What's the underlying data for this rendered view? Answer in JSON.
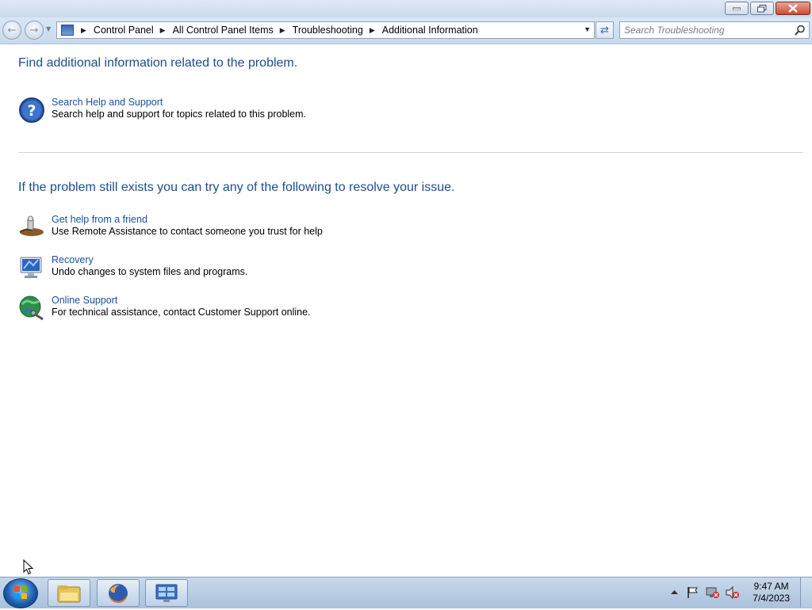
{
  "window": {
    "buttons": [
      "minimize",
      "maximize",
      "close"
    ]
  },
  "navbar": {
    "breadcrumbs": [
      "Control Panel",
      "All Control Panel Items",
      "Troubleshooting",
      "Additional Information"
    ],
    "search_placeholder": "Search Troubleshooting"
  },
  "content": {
    "heading1": "Find additional information related to the problem.",
    "help_task": {
      "link": "Search Help and Support",
      "description": "Search help and support for topics related to this problem.",
      "icon": "help-icon"
    },
    "heading2": "If the problem still exists you can try any of the following to resolve your issue.",
    "tasks": [
      {
        "link": "Get help from a friend",
        "description": "Use Remote Assistance to contact someone you trust for help",
        "icon": "remote-assistance-icon"
      },
      {
        "link": "Recovery",
        "description": "Undo changes to system files and programs.",
        "icon": "recovery-icon"
      },
      {
        "link": "Online Support",
        "description": "For technical assistance, contact Customer Support online.",
        "icon": "online-support-icon"
      }
    ]
  },
  "taskbar": {
    "items": [
      "windows-explorer-icon",
      "firefox-icon",
      "control-panel-icon"
    ],
    "clock_time": "9:47 AM",
    "clock_date": "7/4/2023"
  },
  "colors": {
    "link": "#1a4f9c",
    "heading": "#1e4c8c",
    "taskbar": "#b8cde4"
  }
}
